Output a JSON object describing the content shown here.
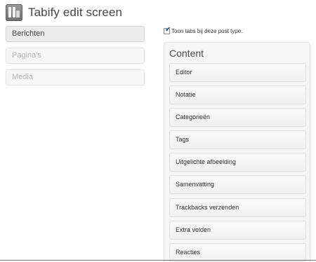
{
  "header": {
    "icon": "tabify-icon",
    "title": "Tabify edit screen"
  },
  "post_types": [
    {
      "label": "Berichten",
      "state": "active"
    },
    {
      "label": "Pagina's",
      "state": "inactive"
    },
    {
      "label": "Media",
      "state": "inactive"
    }
  ],
  "show_tabs": {
    "checked": true,
    "label": "Toon tabs bij deze post type."
  },
  "content_panel": {
    "title": "Content",
    "fields": [
      "Editor",
      "Notatie",
      "Categorieën",
      "Tags",
      "Uitgelichte afbeelding",
      "Samenvatting",
      "Trackbacks verzenden",
      "Extra velden",
      "Reacties"
    ]
  }
}
